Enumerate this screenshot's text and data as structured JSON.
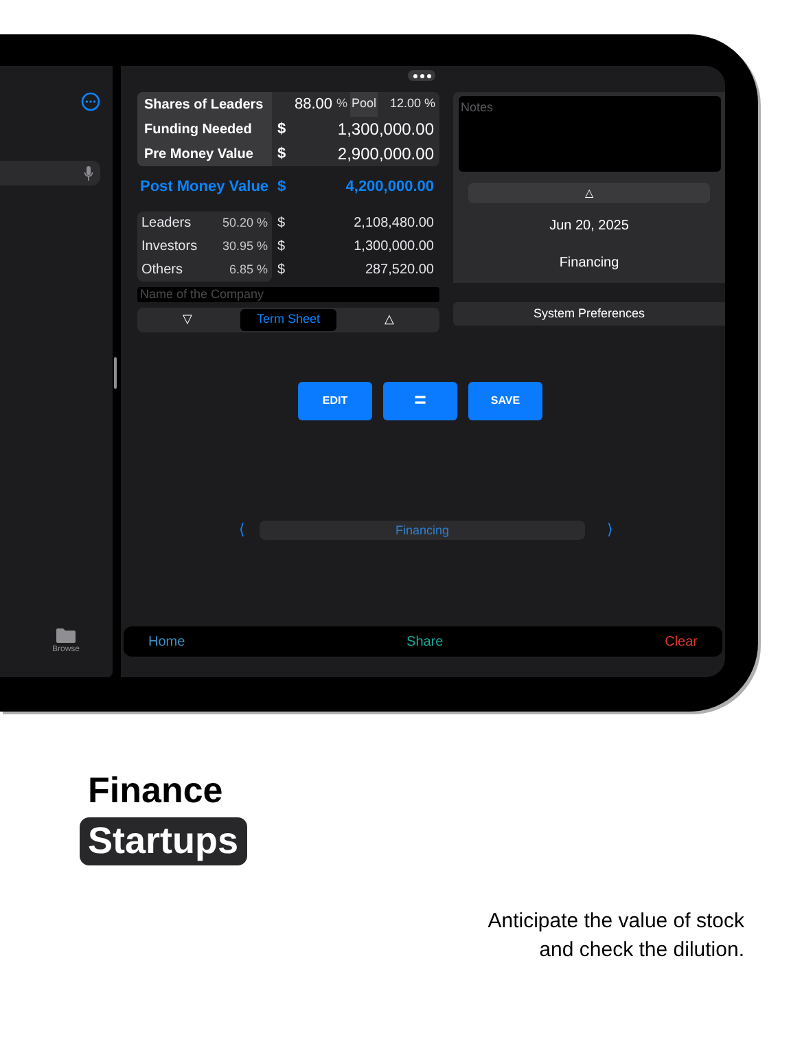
{
  "sidebar": {
    "tab_bar": [
      {
        "label": "Browse"
      }
    ]
  },
  "shares": {
    "label": "Shares of Leaders",
    "value": "88.00",
    "unit": "%",
    "pool_label": "Pool",
    "pool_value": "12.00 %"
  },
  "inputs": [
    {
      "label": "Funding Needed",
      "currency": "$",
      "value": "1,300,000.00"
    },
    {
      "label": "Pre Money Value",
      "currency": "$",
      "value": "2,900,000.00"
    }
  ],
  "result": {
    "label": "Post Money Value",
    "currency": "$",
    "value": "4,200,000.00"
  },
  "split": [
    {
      "label": "Leaders",
      "percent": "50.20 %",
      "currency": "$",
      "value": "2,108,480.00"
    },
    {
      "label": "Investors",
      "percent": "30.95 %",
      "currency": "$",
      "value": "1,300,000.00"
    },
    {
      "label": "Others",
      "percent": "6.85 %",
      "currency": "$",
      "value": "287,520.00"
    }
  ],
  "company_field": {
    "placeholder": "Name of the Company"
  },
  "segments": [
    {
      "label": "▽",
      "selected": false
    },
    {
      "label": "Term Sheet",
      "selected": true
    },
    {
      "label": "△",
      "selected": false
    }
  ],
  "notes": {
    "placeholder": "Notes"
  },
  "collapse_button": "△",
  "date": "Jun 20, 2025",
  "category": "Financing",
  "preferences_button": "System Preferences",
  "actions": [
    "EDIT",
    "=",
    "SAVE"
  ],
  "pager": {
    "prev": "⟨",
    "label": "Financing",
    "next": "⟩"
  },
  "bottom_bar": [
    {
      "label": "Home",
      "color": "#3a8fc4"
    },
    {
      "label": "Share",
      "color": "#1aa89a"
    },
    {
      "label": "Clear",
      "color": "#e0392e"
    }
  ],
  "caption": {
    "title": "Finance",
    "tag": "Startups",
    "text": "Anticipate the value of stock\nand check the dilution."
  }
}
